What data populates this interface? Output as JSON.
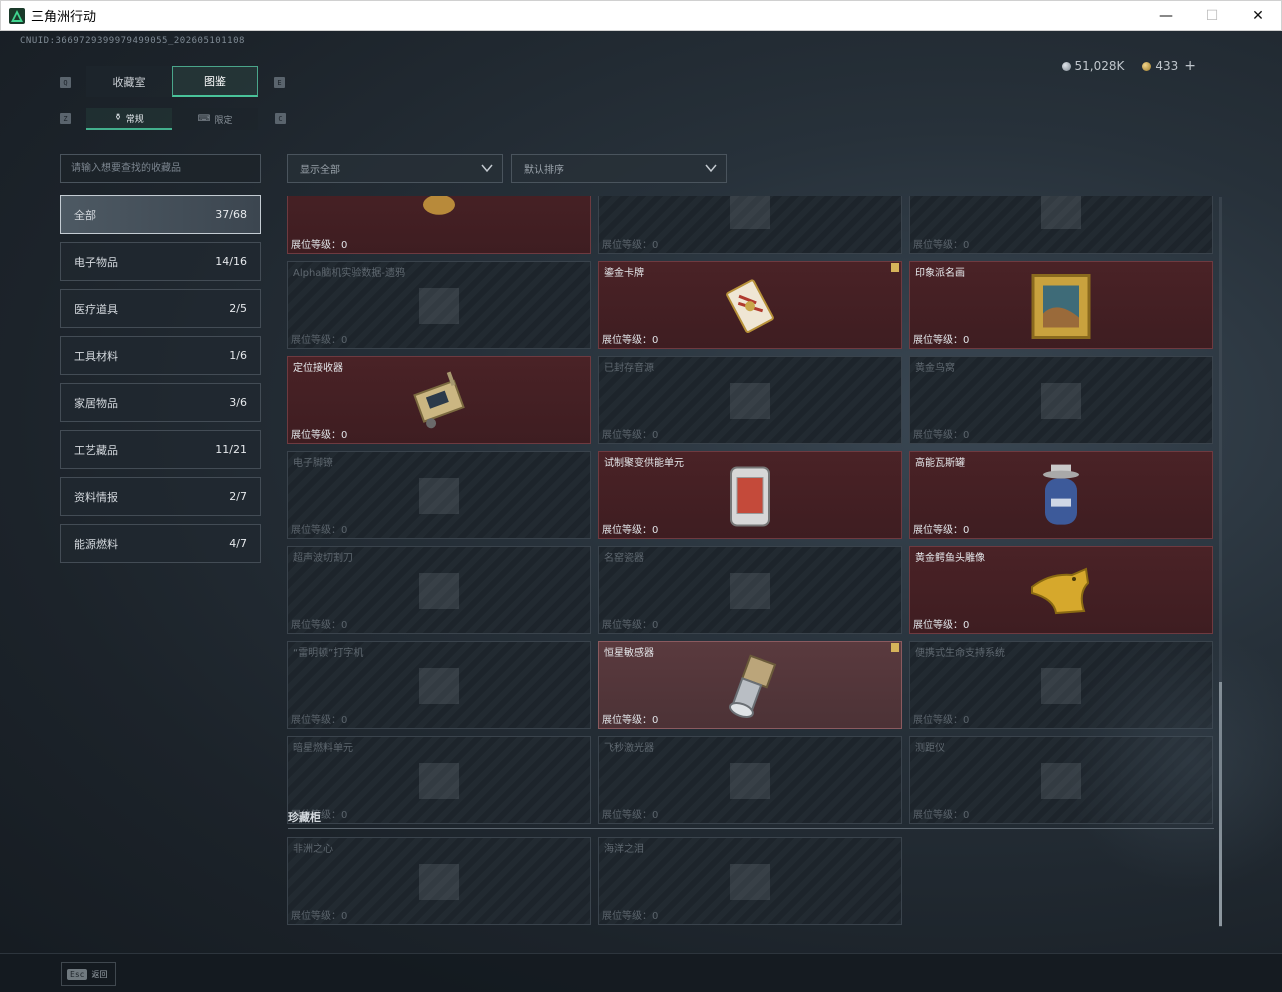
{
  "window": {
    "title": "三角洲行动",
    "minimize": "—",
    "maximize": "☐",
    "close": "✕"
  },
  "uid": "CNUID:3669729399979499055_202605101108",
  "currency": {
    "silver": "51,028K",
    "gold": "433",
    "add": "+"
  },
  "keyhints": {
    "q": "Q",
    "e": "E",
    "z": "Z",
    "c": "C"
  },
  "tabs": {
    "collection": "收藏室",
    "catalog": "图鉴"
  },
  "subtabs": {
    "normal": "常规",
    "limited": "限定"
  },
  "search": {
    "placeholder": "请输入想要查找的收藏品"
  },
  "filters": {
    "display": "显示全部",
    "sort": "默认排序"
  },
  "categories": [
    {
      "label": "全部",
      "count": "37/68"
    },
    {
      "label": "电子物品",
      "count": "14/16"
    },
    {
      "label": "医疗道具",
      "count": "2/5"
    },
    {
      "label": "工具材料",
      "count": "1/6"
    },
    {
      "label": "家居物品",
      "count": "3/6"
    },
    {
      "label": "工艺藏品",
      "count": "11/21"
    },
    {
      "label": "资料情报",
      "count": "2/7"
    },
    {
      "label": "能源燃料",
      "count": "4/7"
    }
  ],
  "level_label": "展位等级：",
  "items": [
    {
      "name": "",
      "level": "0",
      "owned": true
    },
    {
      "name": "",
      "level": "0",
      "owned": false
    },
    {
      "name": "",
      "level": "0",
      "owned": false
    },
    {
      "name": "Alpha脑机实验数据-遗鸦",
      "level": "0",
      "owned": false
    },
    {
      "name": "鎏金卡牌",
      "level": "0",
      "owned": true,
      "badge": true
    },
    {
      "name": "印象派名画",
      "level": "0",
      "owned": true
    },
    {
      "name": "定位接收器",
      "level": "0",
      "owned": true
    },
    {
      "name": "已封存音源",
      "level": "0",
      "owned": false
    },
    {
      "name": "黄金鸟窝",
      "level": "0",
      "owned": false
    },
    {
      "name": "电子脚镣",
      "level": "0",
      "owned": false
    },
    {
      "name": "试制聚变供能单元",
      "level": "0",
      "owned": true
    },
    {
      "name": "高能瓦斯罐",
      "level": "0",
      "owned": true
    },
    {
      "name": "超声波切割刀",
      "level": "0",
      "owned": false
    },
    {
      "name": "名窑瓷器",
      "level": "0",
      "owned": false
    },
    {
      "name": "黄金鳄鱼头雕像",
      "level": "0",
      "owned": true
    },
    {
      "name": "“雷明顿”打字机",
      "level": "0",
      "owned": false
    },
    {
      "name": "恒星敏感器",
      "level": "0",
      "owned": true,
      "badge": true,
      "highlight": true
    },
    {
      "name": "便携式生命支持系统",
      "level": "0",
      "owned": false
    },
    {
      "name": "暗星燃料单元",
      "level": "0",
      "owned": false
    },
    {
      "name": "飞秒激光器",
      "level": "0",
      "owned": false
    },
    {
      "name": "测距仪",
      "level": "0",
      "owned": false
    }
  ],
  "cabinet": {
    "title": "珍藏柜",
    "items": [
      {
        "name": "非洲之心",
        "level": "0",
        "owned": false
      },
      {
        "name": "海洋之泪",
        "level": "0",
        "owned": false
      }
    ]
  },
  "bottom": {
    "esc_key": "Esc",
    "back": "返回"
  }
}
